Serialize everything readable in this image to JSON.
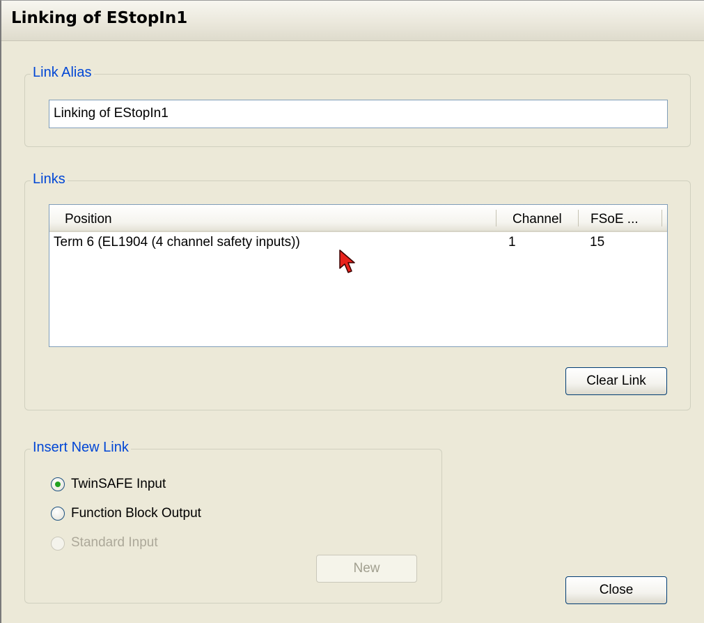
{
  "window": {
    "title": "Linking of EStopIn1"
  },
  "link_alias": {
    "group_label": "Link Alias",
    "value": "Linking of EStopIn1"
  },
  "links": {
    "group_label": "Links",
    "columns": [
      "Position",
      "Channel",
      "FSoE ..."
    ],
    "rows": [
      {
        "position": "Term 6 (EL1904 (4 channel safety inputs))",
        "channel": "1",
        "fsoe": "15"
      }
    ],
    "clear_button": "Clear Link"
  },
  "insert_new_link": {
    "group_label": "Insert New Link",
    "options": [
      {
        "label": "TwinSAFE Input",
        "selected": true,
        "enabled": true
      },
      {
        "label": "Function Block Output",
        "selected": false,
        "enabled": true
      },
      {
        "label": "Standard Input",
        "selected": false,
        "enabled": false
      }
    ],
    "new_button": "New"
  },
  "close_button": "Close",
  "colors": {
    "group_title": "#0046d5",
    "dialog_bg": "#ece9d8",
    "radio_selected_dot": "#21a121"
  }
}
